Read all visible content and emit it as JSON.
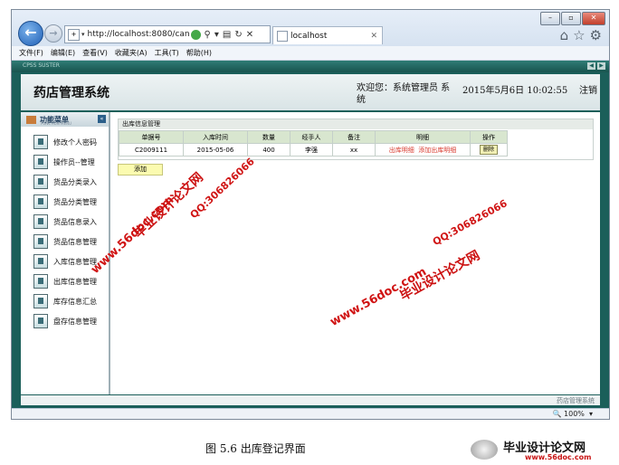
{
  "browser": {
    "address_url": "http://localhost:8080/cangl",
    "tab_title": "localhost",
    "window_controls": [
      "–",
      "▫",
      "✕"
    ],
    "menu": [
      "文件(F)",
      "编辑(E)",
      "查看(V)",
      "收藏夹(A)",
      "工具(T)",
      "帮助(H)"
    ],
    "zoom": "100%",
    "toolbar_icons": [
      "home-icon",
      "star-icon",
      "gear-icon"
    ]
  },
  "app": {
    "tiny_title": "CPSS SUSTER",
    "title": "药店管理系统",
    "welcome": "欢迎您：系统管理员 系统",
    "datetime": "2015年5月6日  10:02:55",
    "logout": "注销"
  },
  "sidebar": {
    "header": "功能菜单",
    "header_sub": "FUNCTION MENU",
    "items": [
      {
        "label": "修改个人密码"
      },
      {
        "label": "操作员--管理"
      },
      {
        "label": "货品分类录入"
      },
      {
        "label": "货品分类管理"
      },
      {
        "label": "货品信息录入"
      },
      {
        "label": "货品信息管理"
      },
      {
        "label": "入库信息管理"
      },
      {
        "label": "出库信息管理"
      },
      {
        "label": "库存信息汇总"
      },
      {
        "label": "盘存信息管理"
      }
    ]
  },
  "main": {
    "panel_title": "出库信息管理",
    "columns": [
      "单据号",
      "入库时间",
      "数量",
      "经手人",
      "备注",
      "明细",
      "操作"
    ],
    "rows": [
      {
        "bill_no": "C2009111",
        "time": "2015-05-06",
        "qty": "400",
        "handler": "李强",
        "note": "xx",
        "detail_link": "出库明细",
        "add_detail_link": "添加出库明细",
        "action": "删除"
      }
    ],
    "add_button": "添加"
  },
  "footer_text": "药店管理系统",
  "watermarks": {
    "site": "www.56doc.com",
    "qq": "QQ:306826066",
    "brand": "毕业设计论文网"
  },
  "caption": "图 5.6 出库登记界面",
  "logo": {
    "name": "毕业设计论文网",
    "url": "www.56doc.com"
  }
}
